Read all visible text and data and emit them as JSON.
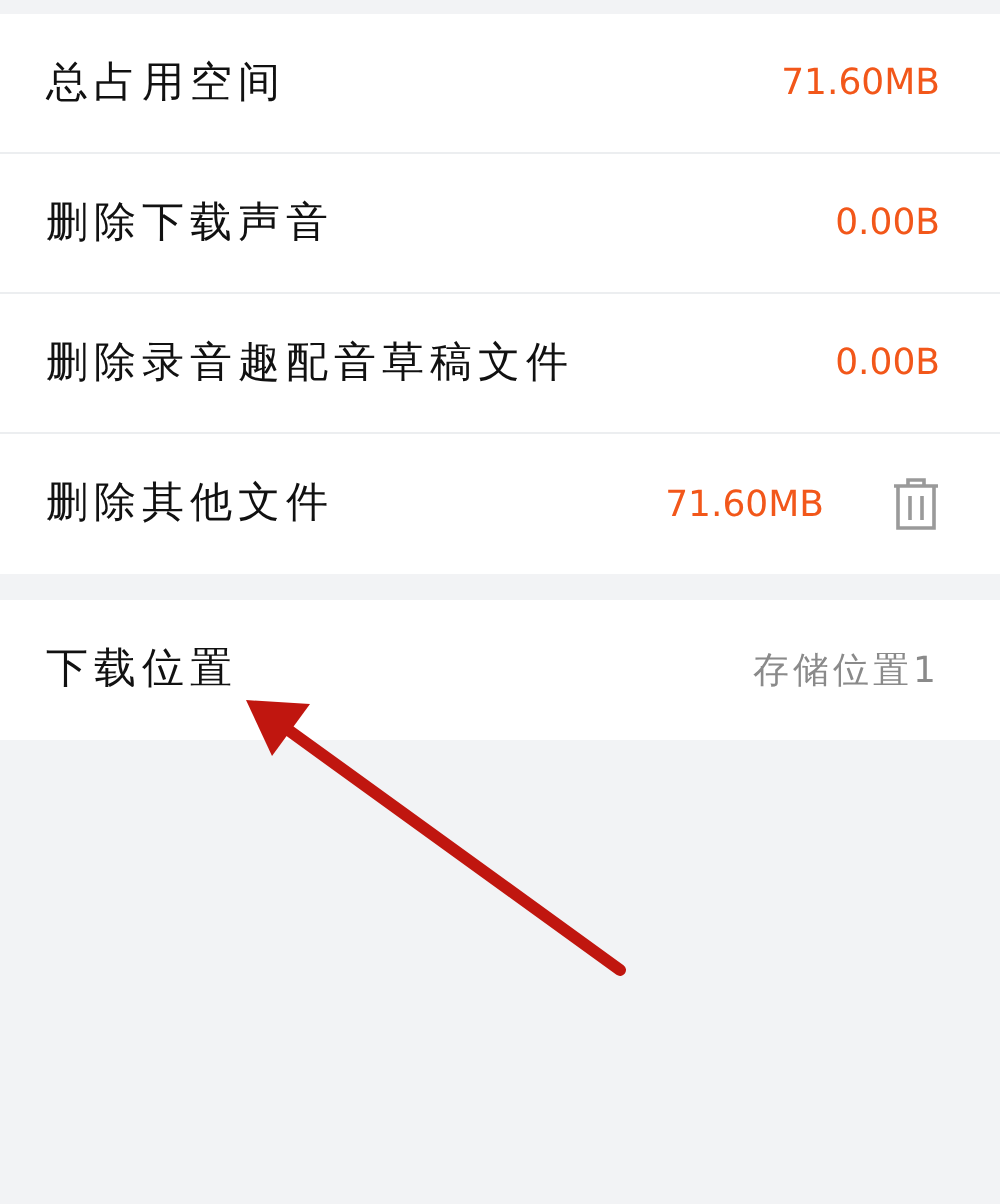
{
  "sections": [
    {
      "rows": [
        {
          "label": "总占用空间",
          "value": "71.60MB",
          "kind": "size"
        },
        {
          "label": "删除下载声音",
          "value": "0.00B",
          "kind": "size"
        },
        {
          "label": "删除录音趣配音草稿文件",
          "value": "0.00B",
          "kind": "size"
        },
        {
          "label": "删除其他文件",
          "value": "71.60MB",
          "kind": "size-delete"
        }
      ]
    },
    {
      "rows": [
        {
          "label": "下载位置",
          "value": "存储位置1",
          "kind": "option"
        }
      ]
    }
  ],
  "annotation": {
    "kind": "arrow"
  }
}
